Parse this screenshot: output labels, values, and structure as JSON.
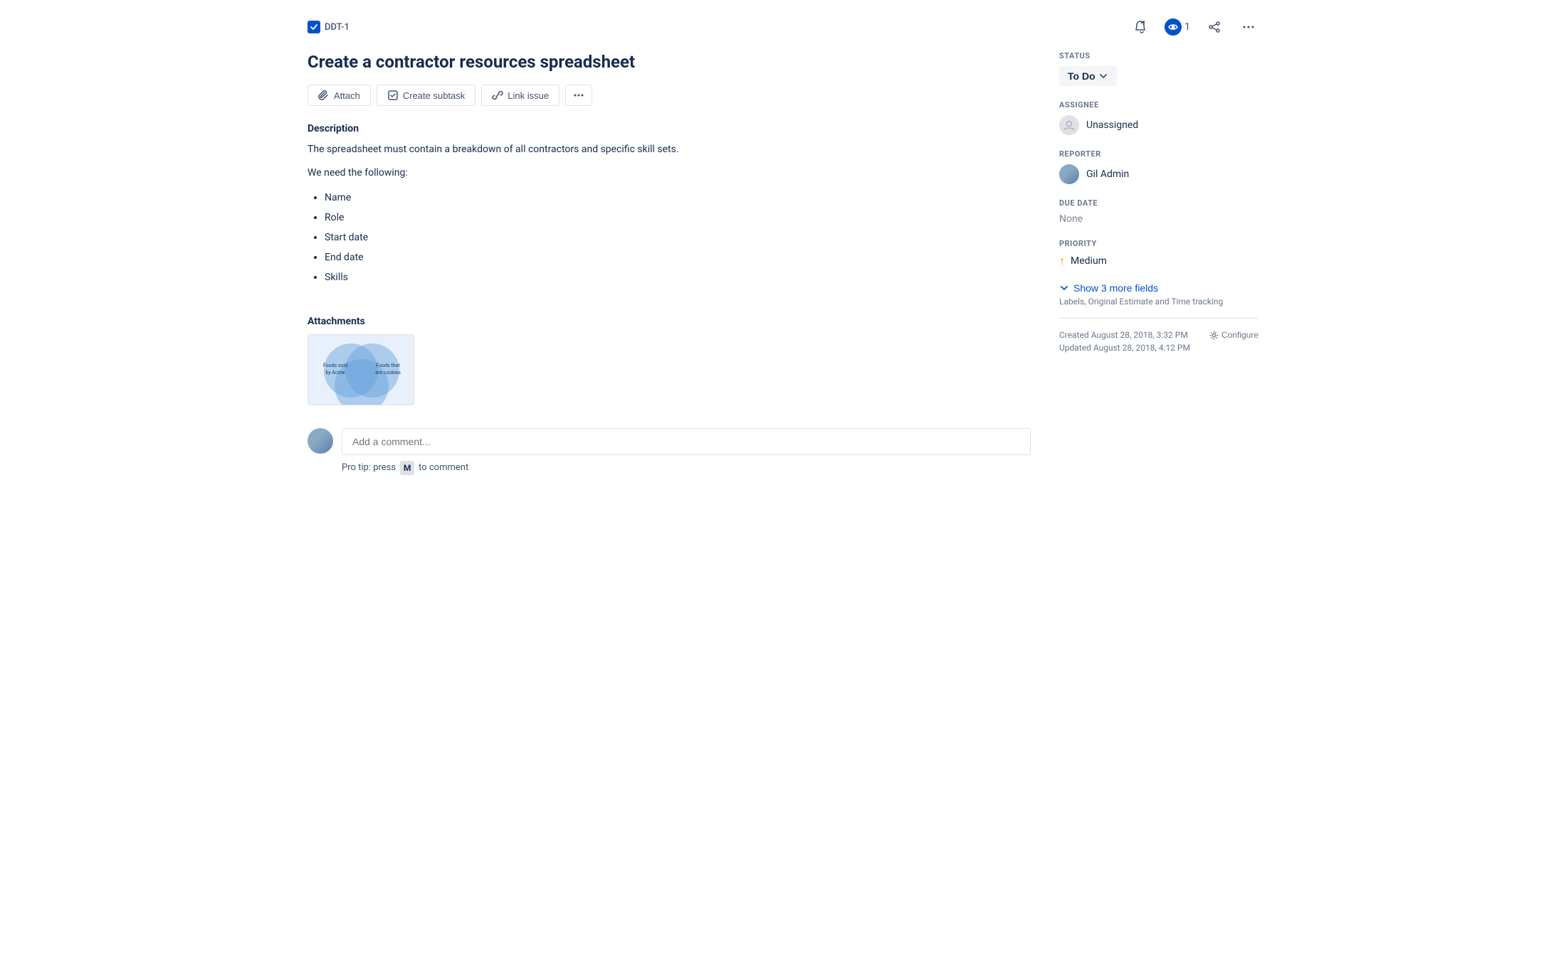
{
  "breadcrumb": {
    "id": "DDT-1"
  },
  "topActions": {
    "watchLabel": "1",
    "moreLabel": "···"
  },
  "issue": {
    "title": "Create a contractor resources spreadsheet",
    "actions": {
      "attach": "Attach",
      "createSubtask": "Create subtask",
      "linkIssue": "Link issue",
      "more": "···"
    },
    "description": {
      "sectionTitle": "Description",
      "paragraph1": "The spreadsheet must contain a breakdown of all contractors and specific skill sets.",
      "paragraph2": "We need the following:",
      "listItems": [
        "Name",
        "Role",
        "Start date",
        "End date",
        "Skills"
      ]
    },
    "attachments": {
      "sectionTitle": "Attachments",
      "vennLabels": [
        "Foods sold by Acme",
        "Foods that are cookies"
      ]
    },
    "comment": {
      "placeholder": "Add a comment...",
      "proTip": "Pro tip: press",
      "key": "M",
      "proTipEnd": "to comment"
    }
  },
  "sidebar": {
    "status": {
      "label": "STATUS",
      "value": "To Do"
    },
    "assignee": {
      "label": "ASSIGNEE",
      "value": "Unassigned"
    },
    "reporter": {
      "label": "REPORTER",
      "value": "Gil Admin"
    },
    "dueDate": {
      "label": "DUE DATE",
      "value": "None"
    },
    "priority": {
      "label": "PRIORITY",
      "value": "Medium"
    },
    "showMoreFields": {
      "label": "Show 3 more fields",
      "subLabel": "Labels, Original Estimate and Time tracking"
    },
    "meta": {
      "created": "Created August 28, 2018, 3:32 PM",
      "updated": "Updated August 28, 2018, 4:12 PM",
      "configure": "Configure"
    }
  }
}
